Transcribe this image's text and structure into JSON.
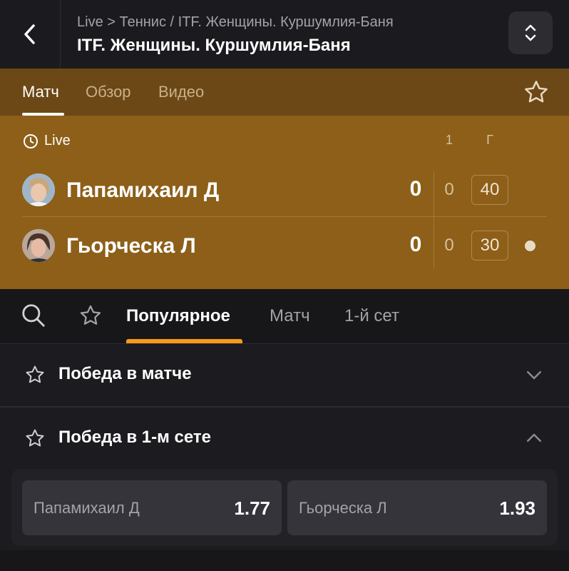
{
  "header": {
    "breadcrumb": "Live > Теннис / ITF. Женщины. Куршумлия-Баня",
    "title": "ITF. Женщины. Куршумлия-Баня"
  },
  "hero_tabs": [
    {
      "label": "Матч",
      "active": true
    },
    {
      "label": "Обзор",
      "active": false
    },
    {
      "label": "Видео",
      "active": false
    }
  ],
  "scoreboard": {
    "status": "Live",
    "column_set1": "1",
    "column_games": "Г",
    "players": [
      {
        "name": "Папамихаил Д",
        "sets": "0",
        "set1": "0",
        "points": "40",
        "serving": false
      },
      {
        "name": "Гьорческа Л",
        "sets": "0",
        "set1": "0",
        "points": "30",
        "serving": true
      }
    ]
  },
  "market_tabs": [
    {
      "label": "Популярное",
      "active": true
    },
    {
      "label": "Матч",
      "active": false
    },
    {
      "label": "1-й сет",
      "active": false
    }
  ],
  "markets": [
    {
      "title": "Победа в матче",
      "expanded": false
    },
    {
      "title": "Победа в 1-м сете",
      "expanded": true,
      "odds": [
        {
          "name": "Папамихаил Д",
          "value": "1.77"
        },
        {
          "name": "Гьорческа Л",
          "value": "1.93"
        }
      ]
    }
  ],
  "colors": {
    "accent": "#f49a1c",
    "hero": "#8d5f19",
    "background": "#17171a"
  }
}
